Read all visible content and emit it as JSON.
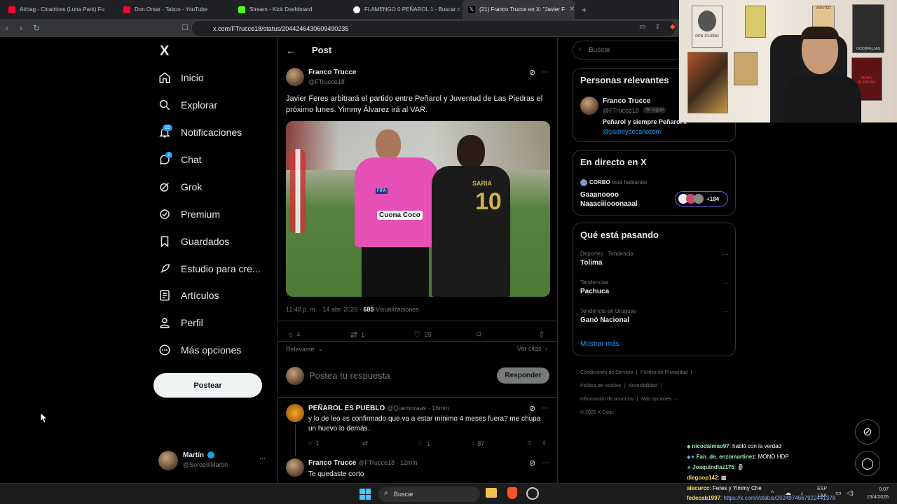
{
  "browser": {
    "tabs": [
      {
        "label": "Airbag - Cicatrices (Luna Park) Fu",
        "color": "#ff0033"
      },
      {
        "label": "Don Omar - Taboo - YouTube",
        "color": "#ff0033"
      },
      {
        "label": "Stream - Kick Dashboard",
        "color": "#53fc18"
      },
      {
        "label": "FLAMENGO 0 PEÑAROL 1 - Buscar c",
        "color": "#ffffff"
      },
      {
        "label": "(21) Franco Trucce en X: \"Javier F",
        "color": "#ffffff"
      }
    ],
    "new_tab": "+",
    "url": "x.com/FTrucce18/status/2044246430609490235"
  },
  "nav": {
    "logo": "X",
    "items": [
      {
        "label": "Inicio",
        "icon": "home-icon"
      },
      {
        "label": "Explorar",
        "icon": "search-icon"
      },
      {
        "label": "Notificaciones",
        "icon": "bell-icon",
        "badge": "15"
      },
      {
        "label": "Chat",
        "icon": "chat-icon",
        "badge": "2"
      },
      {
        "label": "Grok",
        "icon": "grok-icon"
      },
      {
        "label": "Premium",
        "icon": "premium-icon"
      },
      {
        "label": "Guardados",
        "icon": "bookmark-icon"
      },
      {
        "label": "Estudio para cre...",
        "icon": "rocket-icon"
      },
      {
        "label": "Artículos",
        "icon": "article-icon"
      },
      {
        "label": "Perfil",
        "icon": "person-icon"
      },
      {
        "label": "Más opciones",
        "icon": "more-icon"
      }
    ],
    "post_button": "Postear",
    "account": {
      "name": "Martín",
      "handle": "@SordelliMartin",
      "more": "···"
    }
  },
  "post": {
    "header": "Post",
    "author": "Franco Trucce",
    "handle": "@FTrucce18",
    "text": "Javier Feres arbitrará el partido entre Peñarol y Juventud de Las Piedras el próximo lunes. Yimmy Álvarez irá al VAR.",
    "time": "11:48 p. m. · 14 abr. 2026 · ",
    "views_count": "685",
    "views_label": " Visualizaciones",
    "replies": "4",
    "reposts": "1",
    "likes": "25",
    "sort_label": "Relevante",
    "quotes_label": "Ver citas",
    "reply_placeholder": "Postea tu respuesta",
    "reply_button": "Responder",
    "image_texts": {
      "fifa": "FIFA",
      "sponsor": "Cuona Coco",
      "shirt_name": "SARIA",
      "shirt_number": "10"
    }
  },
  "replies": [
    {
      "author": "PEÑAROL ES PUEBLO",
      "handle": "@Quemoraas · 16min",
      "text": "y lo de leo es confirmado que va a estar mínimo 4 meses fuera? me chupa un huevo lo demás.",
      "replies": "1",
      "likes": "1",
      "views": "87"
    },
    {
      "author": "Franco Trucce",
      "handle": "@FTrucce18 · 12min",
      "text": "Te quedaste corto"
    }
  ],
  "sidebar": {
    "search_placeholder": "Buscar",
    "relevant": {
      "title": "Personas relevantes",
      "name": "Franco Trucce",
      "handle": "@FTrucce18",
      "follows_you": "Te sigue",
      "bio": "Peñarol y siempre Peñarol //",
      "bio_link": "@padreydecanocom"
    },
    "live": {
      "title": "En directo en X",
      "host": "CORBO",
      "status": " está hablando",
      "line1": "Gaaanoooo",
      "line2": "Naaaciiiooonaaal",
      "listeners": "+184"
    },
    "trends": {
      "title": "Qué está pasando",
      "items": [
        {
          "meta": "Deportes · Tendencia",
          "name": "Tolima"
        },
        {
          "meta": "Tendencias",
          "name": "Pachuca"
        },
        {
          "meta": "Tendencia en Uruguay",
          "name": "Ganó Nacional"
        }
      ],
      "show_more": "Mostrar más"
    },
    "footer": [
      "Condiciones de Servicio",
      "Política de Privacidad",
      "Política de cookies",
      "Accesibilidad",
      "Información de anuncios",
      "Más opciones ···",
      "© 2026 X Corp."
    ]
  },
  "webcam_posters": [
    "DON JOURNO",
    "WANTED",
    "GOODFELLAS",
    "PEAKY BLINDERS"
  ],
  "chat": [
    {
      "user": "nicodalmao97",
      "msg": ": habló con la verdad",
      "color": "#9ae6b4"
    },
    {
      "user": "Fan_de_enzomartinez",
      "msg": ": MONO HDP",
      "color": "#9ae6b4"
    },
    {
      "user": "Joaquindiaz175",
      "msg": ":",
      "color": "#9ae6b4"
    },
    {
      "user": "diegoop142",
      "msg": ":",
      "color": "#f6e05e"
    },
    {
      "user": "alecurcc",
      "msg": ": Feres y Yimmy Che",
      "color": "#f6e05e"
    },
    {
      "user": "fedecab1997",
      "msg": ": https://x.com/i/status/2024974667922441378",
      "color": "#f6e05e"
    }
  ],
  "taskbar": {
    "search": "Buscar",
    "lang": "ESP",
    "lang2": "LAA",
    "time": "0:07",
    "date": "15/4/2026"
  }
}
